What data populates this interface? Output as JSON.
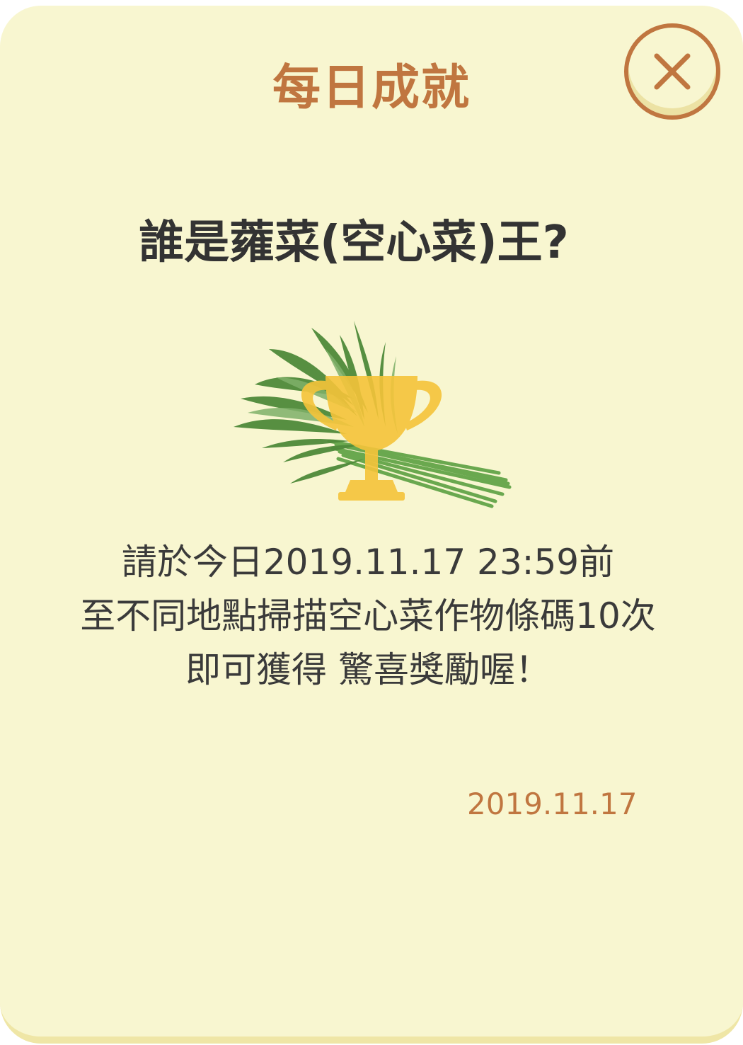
{
  "dialog": {
    "title": "每日成就",
    "close_icon": "close-icon"
  },
  "achievement": {
    "title": "誰是蕹菜(空心菜)王?",
    "illustration_icon": "trophy-icon",
    "illustration_subject": "water-spinach-image",
    "description_lines": [
      "請於今日2019.11.17 23:59前",
      "至不同地點掃描空心菜作物條碼10次",
      "即可獲得 驚喜獎勵喔！"
    ],
    "date": "2019.11.17"
  },
  "colors": {
    "background": "#f8f6d0",
    "accent": "#c07640",
    "title_text": "#333333",
    "trophy": "#f5c43a",
    "leaf": "#4f8a3a"
  }
}
